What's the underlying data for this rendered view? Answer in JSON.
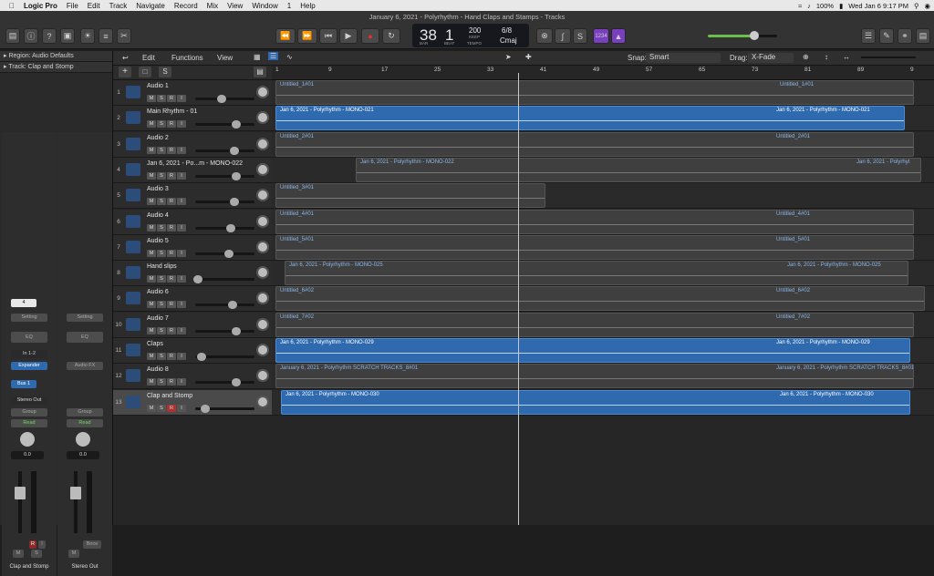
{
  "menubar": {
    "app": "Logic Pro",
    "items": [
      "File",
      "Edit",
      "Track",
      "Navigate",
      "Record",
      "Mix",
      "View",
      "Window",
      "1",
      "Help"
    ],
    "status": {
      "battery": "100%",
      "clock": "Wed Jan 6  9:17 PM"
    }
  },
  "window": {
    "title": "January 6, 2021 - Polyrhythm - Hand Claps and Stamps - Tracks"
  },
  "lcd": {
    "bar": "38",
    "beat": "1",
    "bar_label": "BAR",
    "beat_label": "BEAT",
    "tempo": "200",
    "keep": "KEEP",
    "tempo_label": "TEMPO",
    "sig": "6/8",
    "key": "Cmaj"
  },
  "toolbar": {
    "count_in": "1234"
  },
  "inspector": {
    "region_label": "Region:",
    "region_value": "Audio Defaults",
    "track_label": "Track:",
    "track_value": "Clap and Stomp",
    "strip1": {
      "num": "4",
      "setting": "Setting",
      "eq": "EQ",
      "input": "In 1-2",
      "insert": "Expander",
      "send": "Bus 1",
      "output": "Stereo Out",
      "group": "Group",
      "auto": "Read",
      "pan": "0.0",
      "m": "M",
      "s": "S",
      "name": "Clap and Stomp",
      "r": "R",
      "i": "I"
    },
    "strip2": {
      "setting": "Setting",
      "eq": "EQ",
      "fx": "Audio FX",
      "group": "Group",
      "auto": "Read",
      "pan": "0.0",
      "bounce": "Bnce",
      "m": "M",
      "name": "Stereo Out"
    }
  },
  "trackbar": {
    "edit": "Edit",
    "functions": "Functions",
    "view": "View",
    "snap_label": "Snap:",
    "snap_value": "Smart",
    "drag_label": "Drag:",
    "drag_value": "X-Fade"
  },
  "ruler": {
    "ticks": [
      "1",
      "9",
      "17",
      "25",
      "33",
      "41",
      "49",
      "57",
      "65",
      "73",
      "81",
      "89",
      "9"
    ]
  },
  "tracks": [
    {
      "num": "1",
      "name": "Audio 1"
    },
    {
      "num": "2",
      "name": "Main Rhythm - 01"
    },
    {
      "num": "3",
      "name": "Audio 2"
    },
    {
      "num": "4",
      "name": "Jan 6, 2021 - Po...m - MONO-022"
    },
    {
      "num": "5",
      "name": "Audio 3"
    },
    {
      "num": "6",
      "name": "Audio 4"
    },
    {
      "num": "7",
      "name": "Audio 5"
    },
    {
      "num": "8",
      "name": "Hand slips"
    },
    {
      "num": "9",
      "name": "Audio 6"
    },
    {
      "num": "10",
      "name": "Audio 7"
    },
    {
      "num": "11",
      "name": "Claps"
    },
    {
      "num": "12",
      "name": "Audio 8"
    },
    {
      "num": "13",
      "name": "Clap and Stomp"
    }
  ],
  "regions": [
    {
      "label": "Untitled_1#01",
      "label2": "Untitled_1#01",
      "color": "grey"
    },
    {
      "label": "Jan 6, 2021 - Polyrhythm - MONO-021",
      "label2": "Jan 6, 2021 - Polyrhythm - MONO-021",
      "color": "blue"
    },
    {
      "label": "Untitled_2#01",
      "label2": "Untitled_2#01",
      "color": "grey"
    },
    {
      "label": "Jan 6, 2021 - Polyrhythm - MONO-022",
      "label2": "Jan 6, 2021 - Polyrhyt",
      "color": "grey"
    },
    {
      "label": "Untitled_3#01",
      "label2": "",
      "color": "grey"
    },
    {
      "label": "Untitled_4#01",
      "label2": "Untitled_4#01",
      "color": "grey"
    },
    {
      "label": "Untitled_5#01",
      "label2": "Untitled_5#01",
      "color": "grey"
    },
    {
      "label": "Jan 6, 2021 - Polyrhythm - MONO-025",
      "label2": "Jan 6, 2021 - Polyrhythm - MONO-025",
      "color": "grey"
    },
    {
      "label": "Untitled_6#02",
      "label2": "Untitled_6#02",
      "color": "grey"
    },
    {
      "label": "Untitled_7#02",
      "label2": "Untitled_7#02",
      "color": "grey"
    },
    {
      "label": "Jan 6, 2021 - Polyrhythm - MONO-029",
      "label2": "Jan 6, 2021 - Polyrhythm - MONO-029",
      "color": "blue"
    },
    {
      "label": "January 6, 2021 - Polyrhythm SCRATCH TRACKS_8#01",
      "label2": "January 6, 2021 - Polyrhythm SCRATCH TRACKS_8#01",
      "color": "grey"
    },
    {
      "label": "Jan 6, 2021 - Polyrhythm - MONO-030",
      "label2": "Jan 6, 2021 - Polyrhythm - MONO-030",
      "color": "blue"
    }
  ],
  "msri": {
    "m": "M",
    "s": "S",
    "r": "R",
    "i": "I"
  }
}
